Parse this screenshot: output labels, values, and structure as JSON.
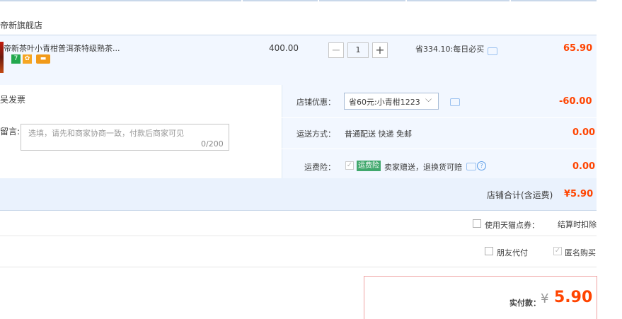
{
  "shop": {
    "name": "帝新旗舰店"
  },
  "item": {
    "title": "帝新茶叶小青柑普洱茶特级熟茶...",
    "tags": [
      "7"
    ],
    "unit_price": "400.00",
    "quantity": "1",
    "minus_label": "−",
    "plus_label": "+",
    "discount_note": "省334.10:每日必买",
    "total": "65.90"
  },
  "invoice": {
    "label": "吴发票"
  },
  "message": {
    "label": "留言:",
    "placeholder": "选填，请先和商家协商一致，付款后商家可见",
    "count": "0/200"
  },
  "shop_discount": {
    "label": "店铺优惠：",
    "selected": "省60元:小青柑1223",
    "value": "-60.00"
  },
  "delivery": {
    "label": "运送方式：",
    "text": "普通配送 快递 免邮",
    "value": "0.00"
  },
  "insurance": {
    "label": "运费险：",
    "badge": "运费险",
    "text": "卖家赠送，退换货可赔",
    "value": "0.00",
    "help": "?"
  },
  "shop_total": {
    "label": "店铺合计(含运费)",
    "value": "¥5.90"
  },
  "tmall_points": {
    "label": "使用天猫点券：",
    "note": "结算时扣除"
  },
  "friend_pay": {
    "label": "朋友代付"
  },
  "anonymous": {
    "label": "匿名购买"
  },
  "payment": {
    "label": "实付款：",
    "currency": "¥",
    "value": "5.90"
  }
}
